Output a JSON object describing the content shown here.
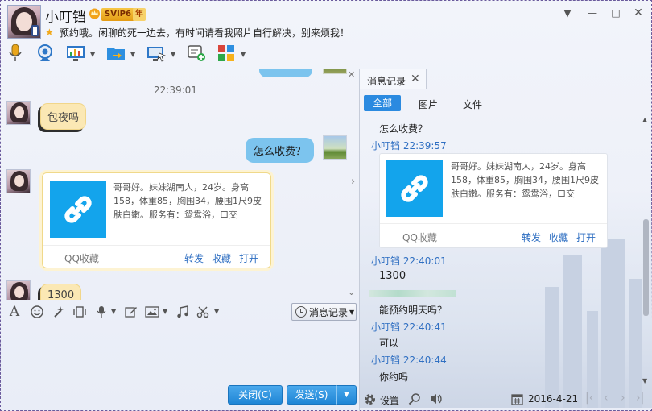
{
  "header": {
    "nickname": "小叮铛",
    "vip_badge": "SVIP6",
    "year_badge": "年",
    "signature": "预约哦。闲聊的死一边去，有时间请看我照片自行解决，别来烦我！"
  },
  "toolbar": {
    "icons": [
      "microphone-icon",
      "video-call-icon",
      "screen-share-icon",
      "send-file-icon",
      "remote-desktop-icon",
      "add-app-icon",
      "apps-icon"
    ]
  },
  "chat": {
    "timestamp": "22:39:01",
    "messages": [
      {
        "side": "peer",
        "text": "包夜吗"
      },
      {
        "side": "self",
        "text": "怎么收费？"
      },
      {
        "side": "peer",
        "type": "link-card",
        "text": "哥哥好。妹妹湖南人，24岁。身高158，体重85，胸围34，腰围1尺9皮肤白嫩。服务有：鸳鸯浴，口交",
        "source": "QQ收藏",
        "actions": [
          "转发",
          "收藏",
          "打开"
        ]
      },
      {
        "side": "peer",
        "text": "1300"
      }
    ]
  },
  "input_toolbar": {
    "history_button": "消息记录"
  },
  "buttons": {
    "close": "关闭(C)",
    "send": "发送(S)"
  },
  "history_panel": {
    "tab_label": "消息记录",
    "filters": [
      "全部",
      "图片",
      "文件"
    ],
    "entries": [
      {
        "type": "text",
        "text": "怎么收费？"
      },
      {
        "type": "meta",
        "text": "小叮铛 22:39:57"
      },
      {
        "type": "link-card",
        "text": "哥哥好。妹妹湖南人，24岁。身高158，体重85，胸围34，腰围1尺9皮肤白嫩。服务有：鸳鸯浴，口交",
        "source": "QQ收藏",
        "actions": [
          "转发",
          "收藏",
          "打开"
        ]
      },
      {
        "type": "meta",
        "text": "小叮铛 22:40:01"
      },
      {
        "type": "text",
        "text": "1300"
      },
      {
        "type": "text",
        "text": "能预约明天吗？"
      },
      {
        "type": "meta",
        "text": "小叮铛 22:40:41"
      },
      {
        "type": "text",
        "text": "可以"
      },
      {
        "type": "meta",
        "text": "小叮铛 22:40:44"
      },
      {
        "type": "text",
        "text": "你约吗"
      }
    ],
    "settings_label": "设置",
    "date": "2016-4-21"
  },
  "colors": {
    "accent_blue": "#2b8ae0",
    "self_bubble": "#7cc4ee",
    "peer_bubble": "#fbe8b4",
    "link_blue": "#2f6fc2"
  }
}
